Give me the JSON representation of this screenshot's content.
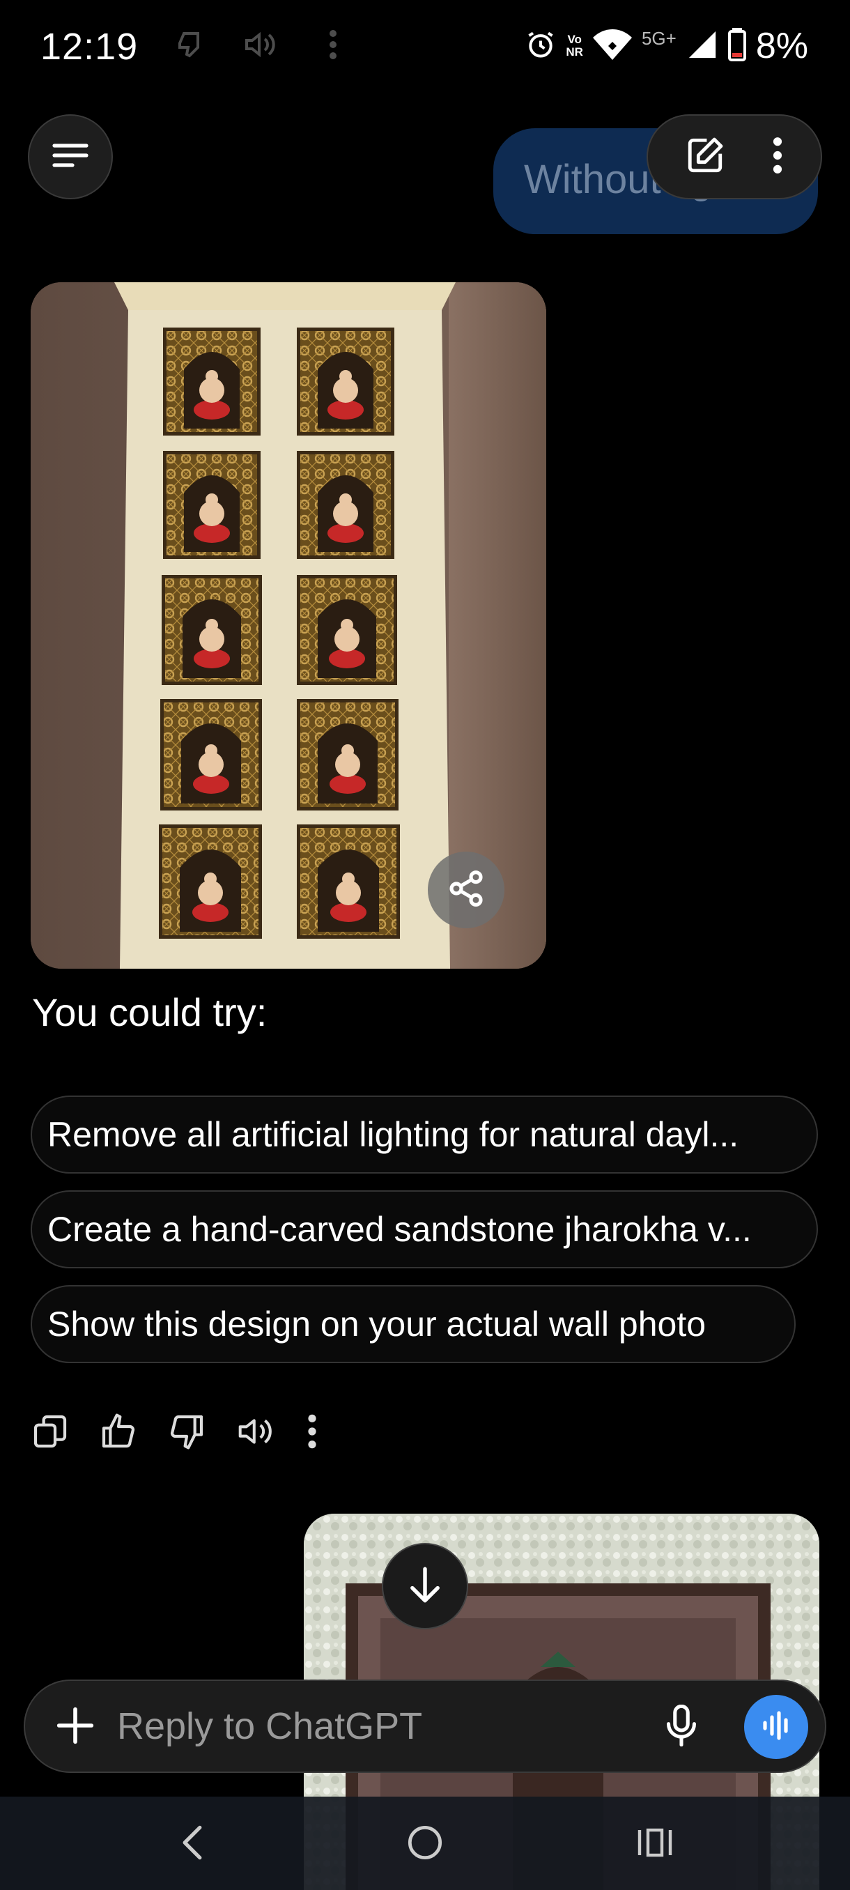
{
  "status_bar": {
    "time": "12:19",
    "network_label": "5G+",
    "vonr_top": "Vo",
    "vonr_bottom": "NR",
    "battery": "8%",
    "icons": [
      "thumb-down-icon",
      "speaker-icon",
      "more-vertical-icon",
      "alarm-icon",
      "vonr-icon",
      "wifi-icon",
      "signal-icon",
      "battery-icon"
    ]
  },
  "header": {
    "menu_icon": "menu-icon",
    "user_message_preview": "Without lig",
    "new_chat_icon": "edit-icon",
    "more_icon": "more-vertical-icon"
  },
  "assistant": {
    "image_description_icon": "share-icon",
    "suggest_heading": "You could try:",
    "suggestions": [
      "Remove all artificial lighting for natural dayl...",
      "Create a hand-carved sandstone jharokha v...",
      "Show this design on your actual wall photo"
    ],
    "actions": [
      "copy-icon",
      "thumb-up-icon",
      "thumb-down-icon",
      "read-aloud-icon",
      "more-vertical-icon"
    ]
  },
  "composer": {
    "placeholder": "Reply to ChatGPT",
    "value": ""
  },
  "nav": [
    "back-icon",
    "home-icon",
    "recents-icon"
  ],
  "colors": {
    "background": "#000000",
    "accent": "#3a8cf0",
    "user_bubble": "#0e2b52"
  }
}
